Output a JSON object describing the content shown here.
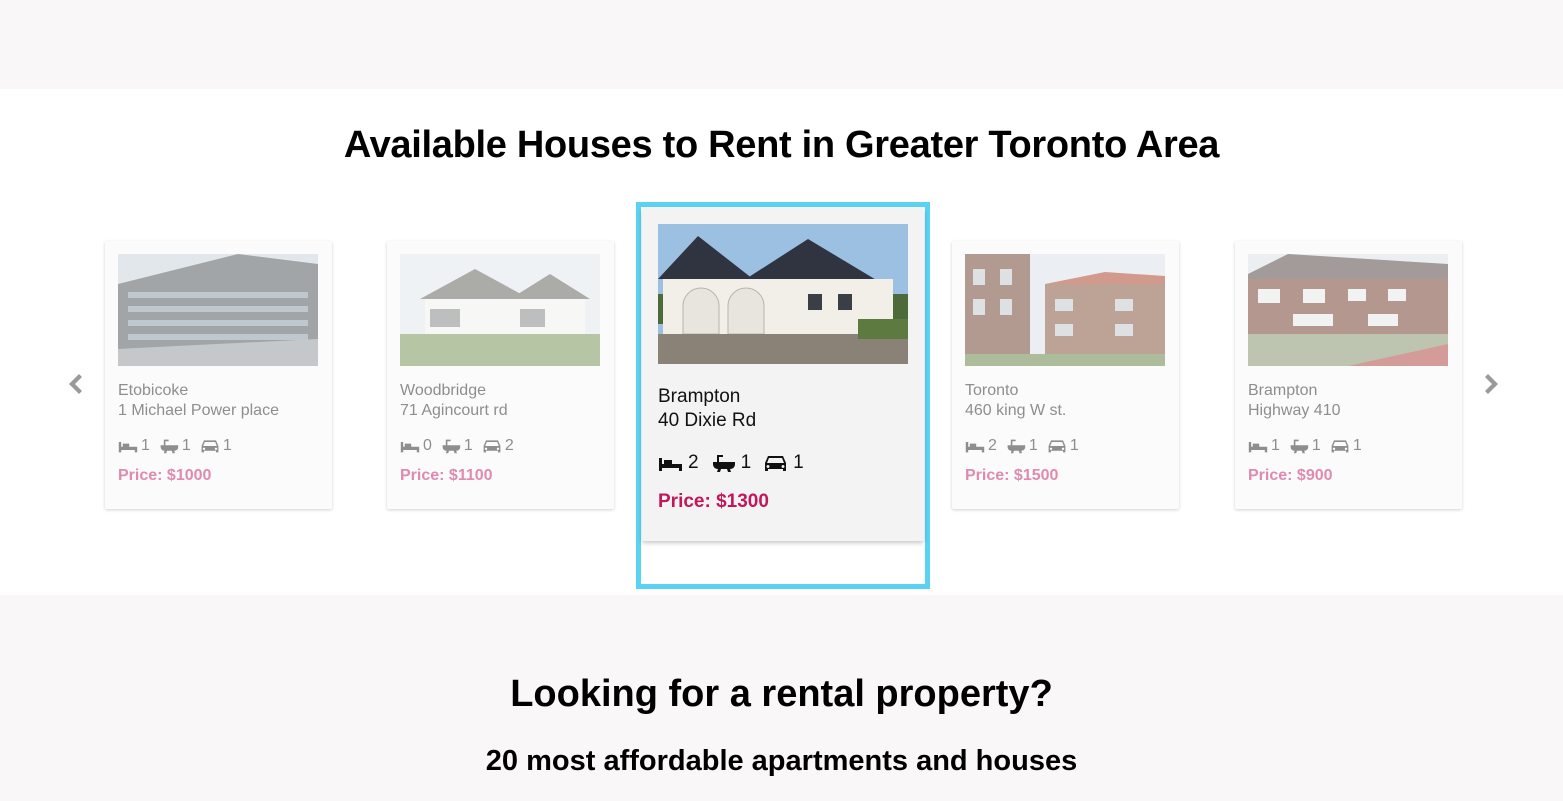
{
  "listings_section": {
    "title": "Available Houses to Rent in Greater Toronto Area",
    "prev_icon": "chevron-left-icon",
    "next_icon": "chevron-right-icon",
    "cards": [
      {
        "city": "Etobicoke",
        "street": "1 Michael Power place",
        "beds": "1",
        "baths": "1",
        "parking": "1",
        "price": "Price: $1000",
        "photo": "modern-apartment-building"
      },
      {
        "city": "Woodbridge",
        "street": "71 Agincourt rd",
        "beds": "0",
        "baths": "1",
        "parking": "2",
        "price": "Price: $1100",
        "photo": "large-white-house"
      },
      {
        "city": "Brampton",
        "street": "40 Dixie Rd",
        "beds": "2",
        "baths": "1",
        "parking": "1",
        "price": "Price: $1300",
        "photo": "white-villa-dark-roof"
      },
      {
        "city": "Toronto",
        "street": "460 king W st.",
        "beds": "2",
        "baths": "1",
        "parking": "1",
        "price": "Price: $1500",
        "photo": "brick-apartment-block"
      },
      {
        "city": "Brampton",
        "street": "Highway 410",
        "beds": "1",
        "baths": "1",
        "parking": "1",
        "price": "Price: $900",
        "photo": "brick-row-houses"
      }
    ],
    "active_index": 2,
    "feature_icons": [
      "bed-icon",
      "bathtub-icon",
      "car-icon"
    ]
  },
  "cta_section": {
    "title": "Looking for a rental property?",
    "subtitle": "20 most affordable apartments and houses"
  },
  "colors": {
    "page_bg": "#f9f7f8",
    "section_bg": "#ffffff",
    "active_price": "#c2185b",
    "dim_price": "#e08ab1",
    "focus_ring": "#5ad2f2"
  }
}
